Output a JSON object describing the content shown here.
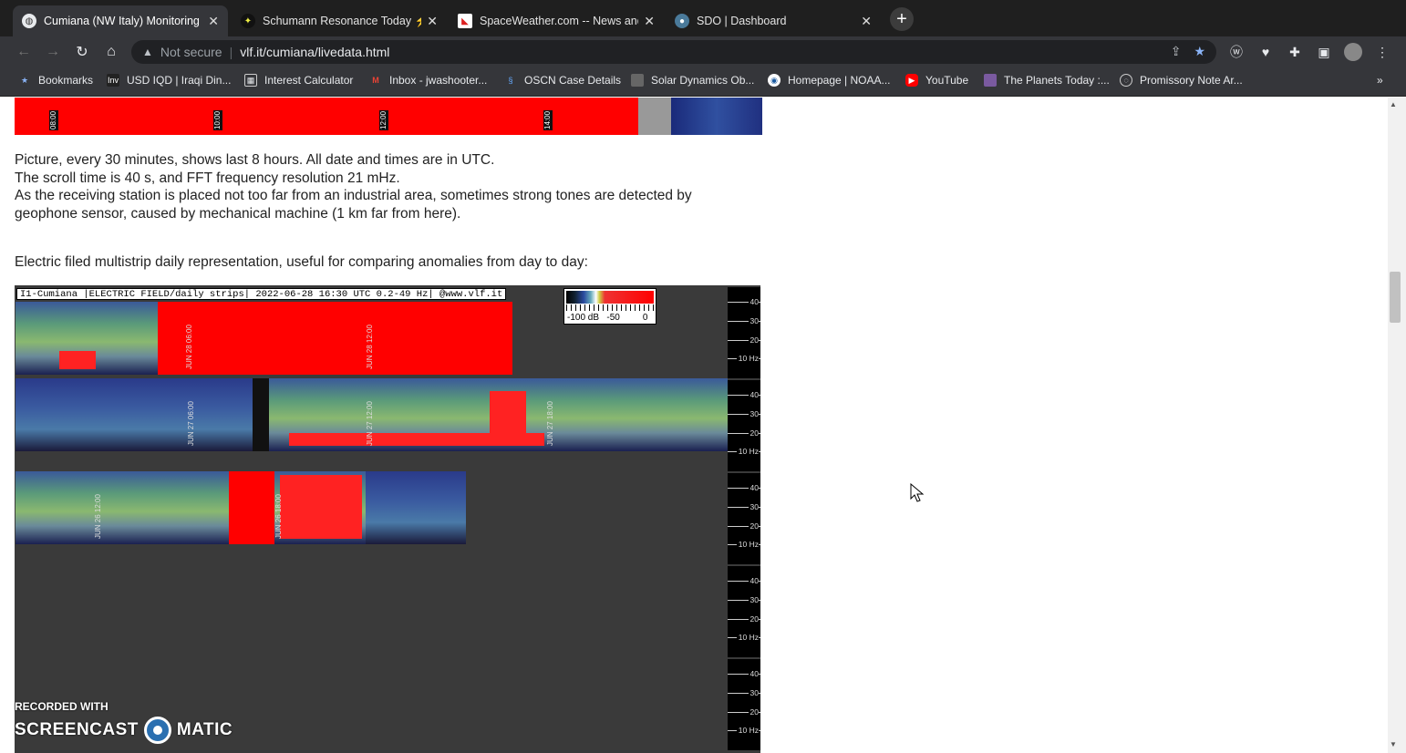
{
  "tabs": [
    {
      "title": "Cumiana (NW Italy) Monitoring S",
      "active": true,
      "favicon": "globe-icon"
    },
    {
      "title": "Schumann Resonance Today ⚡",
      "active": false,
      "favicon": "sr-icon"
    },
    {
      "title": "SpaceWeather.com -- News and",
      "active": false,
      "favicon": "spaceweather-icon"
    },
    {
      "title": "SDO | Dashboard",
      "active": false,
      "favicon": "sdo-icon"
    }
  ],
  "omnibox": {
    "security": "Not secure",
    "url": "vlf.it/cumiana/livedata.html"
  },
  "bookmarks": [
    {
      "label": "Bookmarks",
      "icon": "star-icon"
    },
    {
      "label": "USD IQD | Iraqi Din...",
      "icon": "inv-icon"
    },
    {
      "label": "Interest Calculator",
      "icon": "calculator-icon"
    },
    {
      "label": "Inbox - jwashooter...",
      "icon": "gmail-icon"
    },
    {
      "label": "OSCN Case Details",
      "icon": "oscn-icon"
    },
    {
      "label": "Solar Dynamics Ob...",
      "icon": "sdo-icon"
    },
    {
      "label": "Homepage | NOAA...",
      "icon": "noaa-icon"
    },
    {
      "label": "YouTube",
      "icon": "youtube-icon"
    },
    {
      "label": "The Planets Today :...",
      "icon": "planets-icon"
    },
    {
      "label": "Promissory Note Ar...",
      "icon": "doc-icon"
    }
  ],
  "bookmarks_more": "»",
  "page": {
    "top_strip_labels": [
      "08:00",
      "10:00",
      "12:00",
      "14:00"
    ],
    "para1": [
      "Picture, every 30 minutes, shows last 8 hours. All date and times are in UTC.",
      "The scroll time is 40 s, and FFT frequency resolution 21 mHz.",
      "As the receiving station is placed not too far from an industrial area, sometimes strong tones are detected by",
      "geophone sensor, caused by mechanical machine (1 km far from here)."
    ],
    "para2": "Electric filed multistrip daily representation, useful for comparing anomalies from day to day:",
    "spectrogram": {
      "header": "I1-Cumiana |ELECTRIC FIELD/daily strips| 2022-06-28 16:30 UTC 0.2-49 Hz| @www.vlf.it",
      "legend": {
        "min_label": "-100 dB",
        "mid_label": "-50",
        "max_label": "0"
      },
      "ruler_labels": [
        "40",
        "30",
        "20",
        "10 Hz"
      ],
      "strip_time_labels": [
        [
          "JUN 28 06:00",
          "JUN 28 12:00"
        ],
        [
          "JUN 27 06:00",
          "JUN 27 12:00",
          "JUN 27 18:00"
        ],
        [
          "JUN 26 12:00",
          "JUN 26 18:00"
        ]
      ]
    }
  },
  "watermark": {
    "line1": "RECORDED WITH",
    "left": "SCREENCAST",
    "right": "MATIC"
  },
  "colors": {
    "spectrum_red": "#ff0000",
    "bookmark_star": "#8ab4f8"
  }
}
